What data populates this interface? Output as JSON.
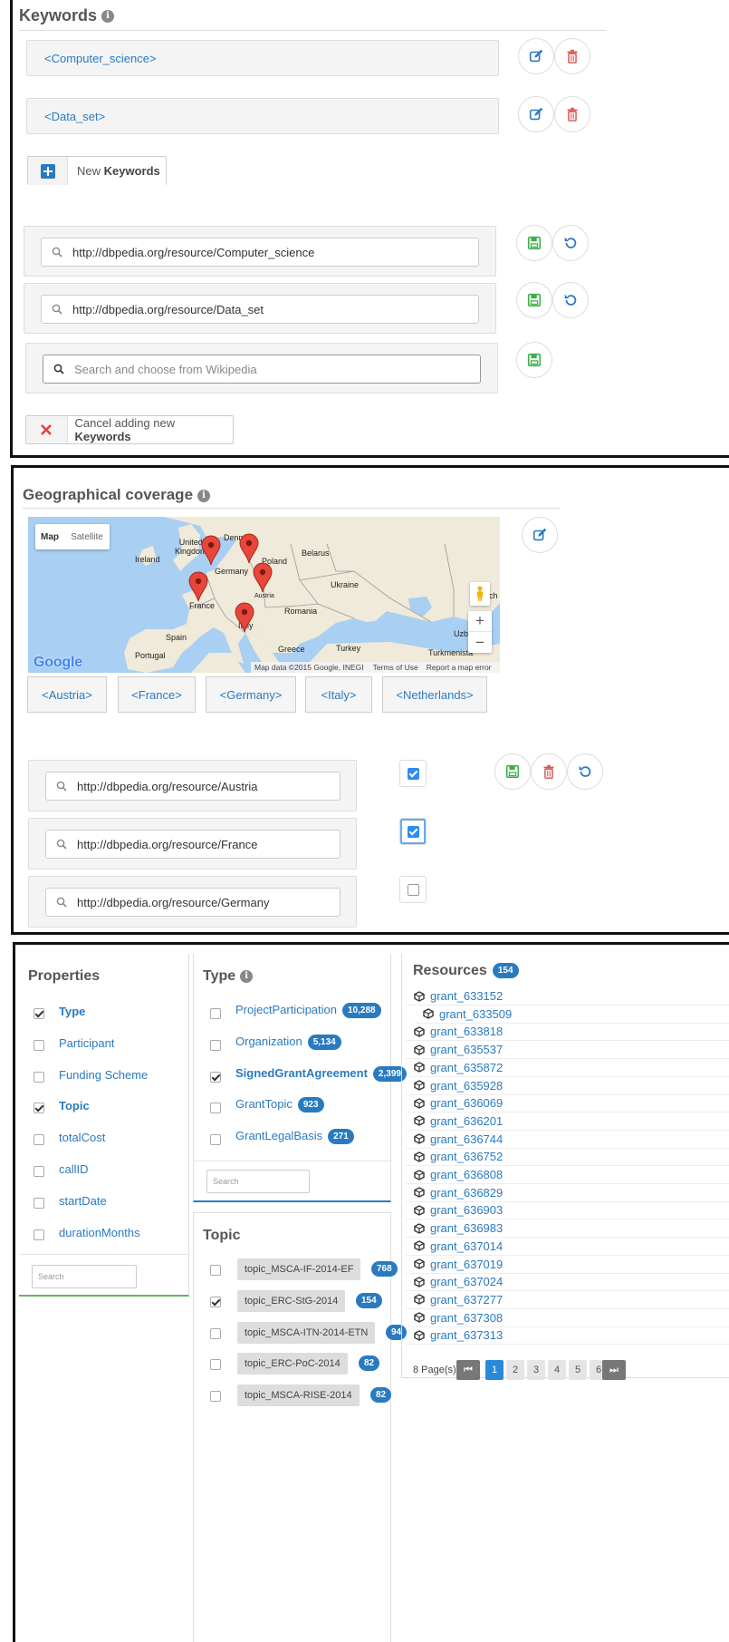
{
  "keywords": {
    "title": "Keywords",
    "items": [
      "<Computer_science>",
      "<Data_set>"
    ],
    "new_button": {
      "prefix": "New ",
      "strong": "Keywords"
    },
    "editor": {
      "values": [
        "http://dbpedia.org/resource/Computer_science",
        "http://dbpedia.org/resource/Data_set"
      ],
      "placeholder": "Search and choose from Wikipedia"
    },
    "cancel_button": {
      "prefix": "Cancel adding new ",
      "strong": "Keywords"
    }
  },
  "geo": {
    "title": "Geographical coverage",
    "map": {
      "type_buttons": [
        "Map",
        "Satellite"
      ],
      "labels": {
        "united_kingdom": "United\nKingdom",
        "ireland": "Ireland",
        "denmark": "Denma",
        "belarus": "Belarus",
        "poland": "Poland",
        "germany": "Germany",
        "austria": "Austria",
        "ukraine": "Ukraine",
        "france": "France",
        "romania": "Romania",
        "italy": "Italy",
        "spain": "Spain",
        "portugal": "Portugal",
        "greece": "Greece",
        "turkey": "Turkey",
        "uzb": "Uzb",
        "turkmenistan": "Turkmenista",
        "ch": "ch"
      },
      "zoom_in": "+",
      "zoom_out": "−",
      "logo": "Google",
      "attribution": "Map data ©2015 Google, INEGI",
      "terms": "Terms of Use",
      "report": "Report a map error"
    },
    "countries": [
      "<Austria>",
      "<France>",
      "<Germany>",
      "<Italy>",
      "<Netherlands>"
    ],
    "uris": [
      "http://dbpedia.org/resource/Austria",
      "http://dbpedia.org/resource/France",
      "http://dbpedia.org/resource/Germany"
    ],
    "checked": [
      true,
      true,
      false
    ]
  },
  "facets": {
    "properties": {
      "title": "Properties",
      "items": [
        {
          "label": "Type",
          "checked": true
        },
        {
          "label": "Participant",
          "checked": false
        },
        {
          "label": "Funding Scheme",
          "checked": false
        },
        {
          "label": "Topic",
          "checked": true
        },
        {
          "label": "totalCost",
          "checked": false
        },
        {
          "label": "callID",
          "checked": false
        },
        {
          "label": "startDate",
          "checked": false
        },
        {
          "label": "durationMonths",
          "checked": false
        }
      ],
      "search_placeholder": "Search"
    },
    "type": {
      "title": "Type",
      "items": [
        {
          "label": "ProjectParticipation",
          "count": "10,288",
          "checked": false
        },
        {
          "label": "Organization",
          "count": "5,134",
          "checked": false
        },
        {
          "label": "SignedGrantAgreement",
          "count": "2,399",
          "checked": true
        },
        {
          "label": "GrantTopic",
          "count": "923",
          "checked": false
        },
        {
          "label": "GrantLegalBasis",
          "count": "271",
          "checked": false
        }
      ],
      "search_placeholder": "Search"
    },
    "topic": {
      "title": "Topic",
      "items": [
        {
          "label": "topic_MSCA-IF-2014-EF",
          "count": "768",
          "checked": false
        },
        {
          "label": "topic_ERC-StG-2014",
          "count": "154",
          "checked": true
        },
        {
          "label": "topic_MSCA-ITN-2014-ETN",
          "count": "94",
          "checked": false
        },
        {
          "label": "topic_ERC-PoC-2014",
          "count": "82",
          "checked": false
        },
        {
          "label": "topic_MSCA-RISE-2014",
          "count": "82",
          "checked": false
        }
      ]
    },
    "resources": {
      "title": "Resources",
      "count": "154",
      "items": [
        "grant_633152",
        "grant_633509",
        "grant_633818",
        "grant_635537",
        "grant_635872",
        "grant_635928",
        "grant_636069",
        "grant_636201",
        "grant_636744",
        "grant_636752",
        "grant_636808",
        "grant_636829",
        "grant_636903",
        "grant_636983",
        "grant_637014",
        "grant_637019",
        "grant_637024",
        "grant_637277",
        "grant_637308",
        "grant_637313"
      ],
      "pages_label": "8 Page(s):",
      "pages": [
        "1",
        "2",
        "3",
        "4",
        "5",
        "6"
      ],
      "current_page": "1"
    }
  },
  "colors": {
    "link": "#2a7ac0",
    "edit": "#2a7ac0",
    "delete": "#d9534f",
    "save": "#3fae49",
    "badge": "#2a7ac0",
    "pin": "#e8463b"
  }
}
